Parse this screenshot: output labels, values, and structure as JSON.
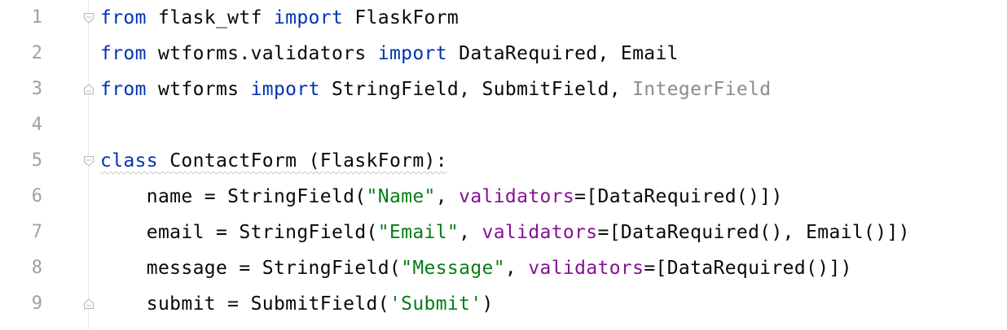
{
  "editor": {
    "language": "python",
    "colors": {
      "keyword": "#0033b3",
      "string": "#067d17",
      "parameter": "#871094",
      "unused": "#8c8c8c",
      "text": "#080808",
      "line_number": "#a0a0a0"
    },
    "lines": [
      {
        "number": "1",
        "tokens": [
          {
            "text": "from",
            "kind": "kw"
          },
          {
            "text": " flask_wtf ",
            "kind": "plain"
          },
          {
            "text": "import",
            "kind": "kw"
          },
          {
            "text": " FlaskForm",
            "kind": "plain"
          }
        ]
      },
      {
        "number": "2",
        "tokens": [
          {
            "text": "from",
            "kind": "kw"
          },
          {
            "text": " wtforms.validators ",
            "kind": "plain"
          },
          {
            "text": "import",
            "kind": "kw"
          },
          {
            "text": " DataRequired, Email",
            "kind": "plain"
          }
        ]
      },
      {
        "number": "3",
        "tokens": [
          {
            "text": "from",
            "kind": "kw"
          },
          {
            "text": " wtforms ",
            "kind": "plain"
          },
          {
            "text": "import",
            "kind": "kw"
          },
          {
            "text": " StringField, SubmitField, ",
            "kind": "plain"
          },
          {
            "text": "IntegerField",
            "kind": "unused"
          }
        ]
      },
      {
        "number": "4",
        "tokens": []
      },
      {
        "number": "5",
        "tokens": [
          {
            "text": "class",
            "kind": "kw"
          },
          {
            "text": " ContactForm (FlaskForm):",
            "kind": "plain"
          }
        ]
      },
      {
        "number": "6",
        "tokens": [
          {
            "text": "    name = StringField(",
            "kind": "plain"
          },
          {
            "text": "\"Name\"",
            "kind": "str"
          },
          {
            "text": ", ",
            "kind": "plain"
          },
          {
            "text": "validators",
            "kind": "param"
          },
          {
            "text": "=[DataRequired()])",
            "kind": "plain"
          }
        ]
      },
      {
        "number": "7",
        "tokens": [
          {
            "text": "    email = StringField(",
            "kind": "plain"
          },
          {
            "text": "\"Email\"",
            "kind": "str"
          },
          {
            "text": ", ",
            "kind": "plain"
          },
          {
            "text": "validators",
            "kind": "param"
          },
          {
            "text": "=[DataRequired(), Email()])",
            "kind": "plain"
          }
        ]
      },
      {
        "number": "8",
        "tokens": [
          {
            "text": "    message = StringField(",
            "kind": "plain"
          },
          {
            "text": "\"Message\"",
            "kind": "str"
          },
          {
            "text": ", ",
            "kind": "plain"
          },
          {
            "text": "validators",
            "kind": "param"
          },
          {
            "text": "=[DataRequired()])",
            "kind": "plain"
          }
        ]
      },
      {
        "number": "9",
        "tokens": [
          {
            "text": "    submit = SubmitField(",
            "kind": "plain"
          },
          {
            "text": "'Submit'",
            "kind": "str"
          },
          {
            "text": ")",
            "kind": "plain"
          }
        ]
      }
    ],
    "fold_markers": [
      {
        "line": "1",
        "type": "fold-start-icon"
      },
      {
        "line": "3",
        "type": "fold-end-icon"
      },
      {
        "line": "5",
        "type": "fold-start-icon"
      },
      {
        "line": "9",
        "type": "fold-end-icon"
      }
    ],
    "warning_line": "5"
  }
}
